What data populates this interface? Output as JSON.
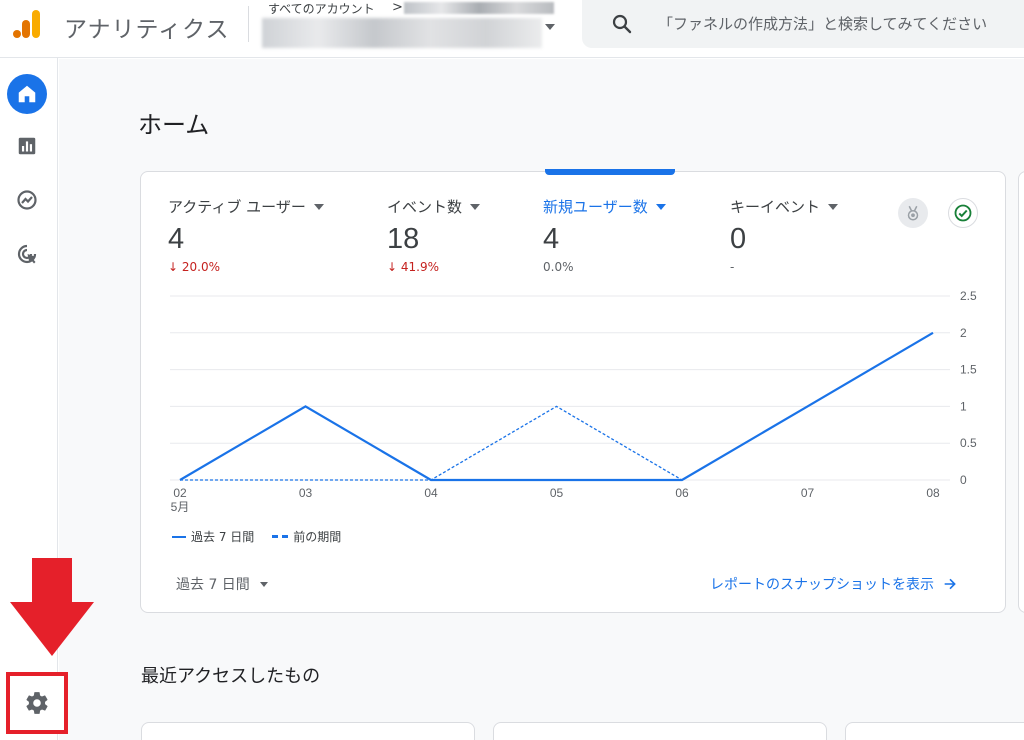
{
  "app": {
    "title": "アナリティクス",
    "account_crumb": "すべてのアカウント",
    "crumb_separator": ">"
  },
  "search": {
    "placeholder": "「ファネルの作成方法」と検索してみてください"
  },
  "rail": {
    "items": [
      {
        "name": "home",
        "icon": "home-icon"
      },
      {
        "name": "reports",
        "icon": "bar-chart-icon"
      },
      {
        "name": "explore",
        "icon": "explore-icon"
      },
      {
        "name": "advertising",
        "icon": "cursor-target-icon"
      },
      {
        "name": "admin",
        "icon": "gear-icon"
      }
    ]
  },
  "page": {
    "title": "ホーム"
  },
  "metrics": [
    {
      "label": "アクティブ ユーザー",
      "value": "4",
      "delta": "20.0%",
      "trend": "down"
    },
    {
      "label": "イベント数",
      "value": "18",
      "delta": "41.9%",
      "trend": "down"
    },
    {
      "label": "新規ユーザー数",
      "value": "4",
      "delta": "0.0%",
      "trend": "flat"
    },
    {
      "label": "キーイベント",
      "value": "0",
      "delta": "-",
      "trend": "none"
    }
  ],
  "colors": {
    "accent": "#1a73e8",
    "negative": "#c5221f",
    "annotation_red": "#e5202a"
  },
  "chart_data": {
    "type": "line",
    "x": [
      "02",
      "03",
      "04",
      "05",
      "06",
      "07",
      "08"
    ],
    "x_sub_label": "5月",
    "series": [
      {
        "name": "過去 7 日間",
        "style": "solid",
        "values": [
          0,
          1,
          0,
          0,
          0,
          1,
          2
        ]
      },
      {
        "name": "前の期間",
        "style": "dashed",
        "values": [
          0,
          0,
          0,
          1,
          0,
          null,
          null
        ]
      }
    ],
    "yticks": [
      "0",
      "0.5",
      "1",
      "1.5",
      "2",
      "2.5"
    ],
    "ylim": [
      0,
      2.5
    ],
    "y_axis_side": "right",
    "grid": true
  },
  "legend": {
    "current": "過去 7 日間",
    "previous": "前の期間"
  },
  "footer": {
    "date_range": "過去 7 日間",
    "snapshot_link": "レポートのスナップショットを表示"
  },
  "recent": {
    "title": "最近アクセスしたもの"
  }
}
